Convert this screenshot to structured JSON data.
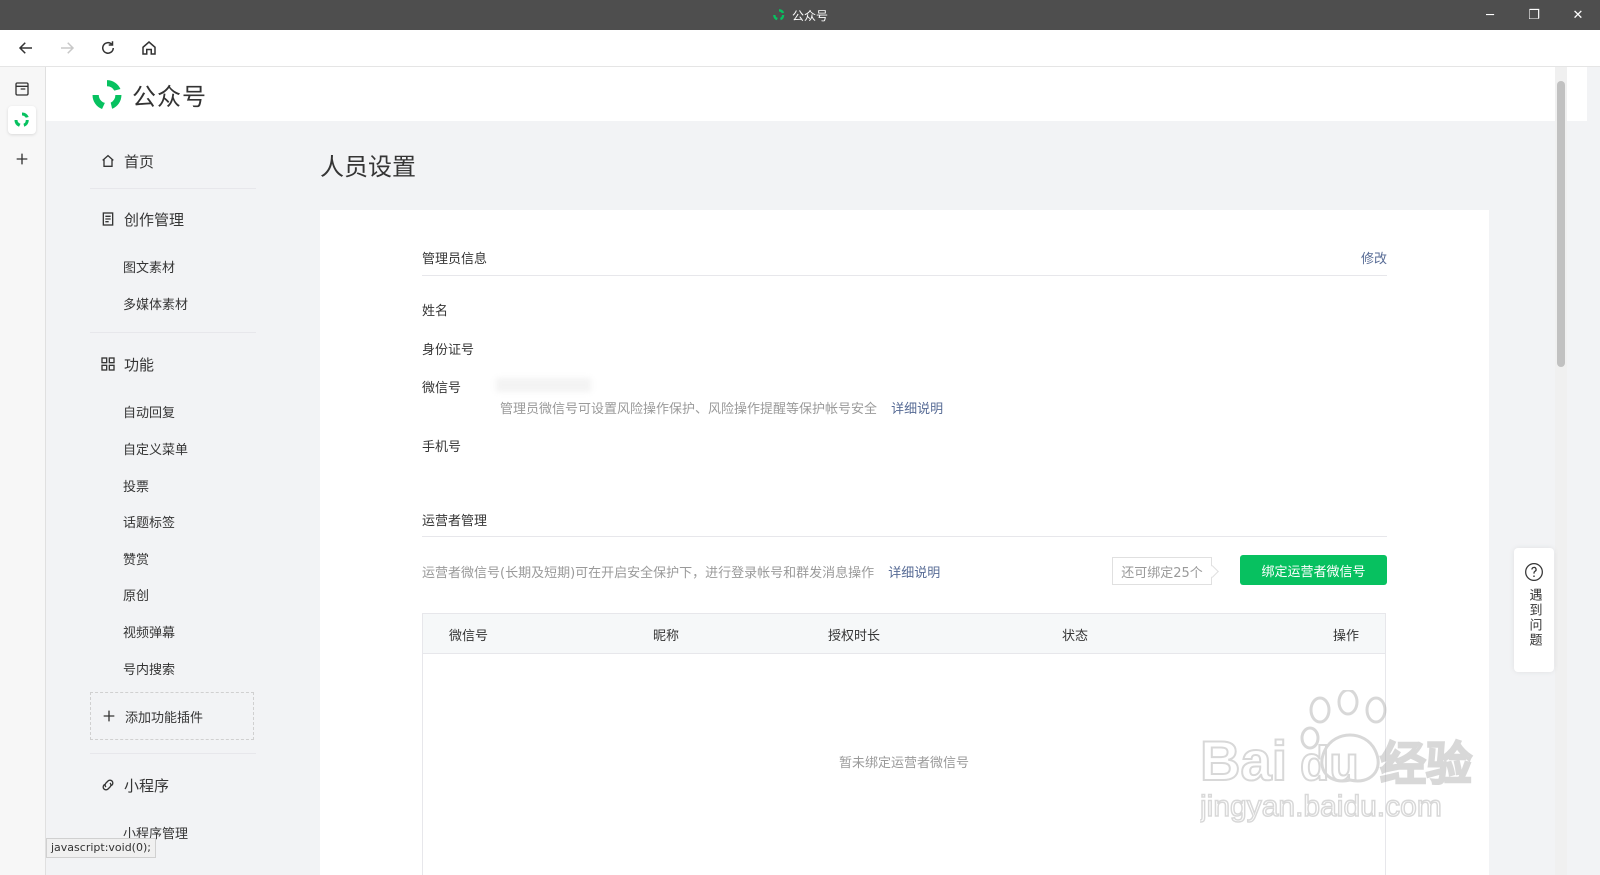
{
  "window": {
    "title": "公众号"
  },
  "browser": {
    "status_text": "javascript:void(0);"
  },
  "header": {
    "logo_text": "公众号"
  },
  "sidebar": {
    "home": "首页",
    "creation": {
      "label": "创作管理",
      "items": [
        "图文素材",
        "多媒体素材"
      ]
    },
    "features": {
      "label": "功能",
      "items": [
        "自动回复",
        "自定义菜单",
        "投票",
        "话题标签",
        "赞赏",
        "原创",
        "视频弹幕",
        "号内搜索"
      ]
    },
    "add_plugin": "添加功能插件",
    "miniprogram": {
      "label": "小程序",
      "items": [
        "小程序管理"
      ]
    }
  },
  "page": {
    "title": "人员设置"
  },
  "admin": {
    "section_title": "管理员信息",
    "edit_link": "修改",
    "fields": {
      "name": "姓名",
      "id_number": "身份证号",
      "wechat": "微信号",
      "phone": "手机号"
    },
    "wechat_tip": "管理员微信号可设置风险操作保护、风险操作提醒等保护帐号安全",
    "detail_link": "详细说明"
  },
  "operators": {
    "section_title": "运营者管理",
    "tip": "运营者微信号(长期及短期)可在开启安全保护下，进行登录帐号和群发消息操作",
    "detail_link": "详细说明",
    "quota": "还可绑定25个",
    "bind_button": "绑定运营者微信号",
    "table": {
      "columns": [
        "微信号",
        "昵称",
        "授权时长",
        "状态",
        "操作"
      ],
      "empty": "暂未绑定运营者微信号"
    }
  },
  "help": {
    "label": "遇到问题"
  },
  "watermark": {
    "line1": "Bai",
    "line2": "du",
    "line3": "经验",
    "url": "jingyan.baidu.com"
  },
  "colors": {
    "accent_green": "#07c160",
    "link_blue": "#576b95"
  }
}
